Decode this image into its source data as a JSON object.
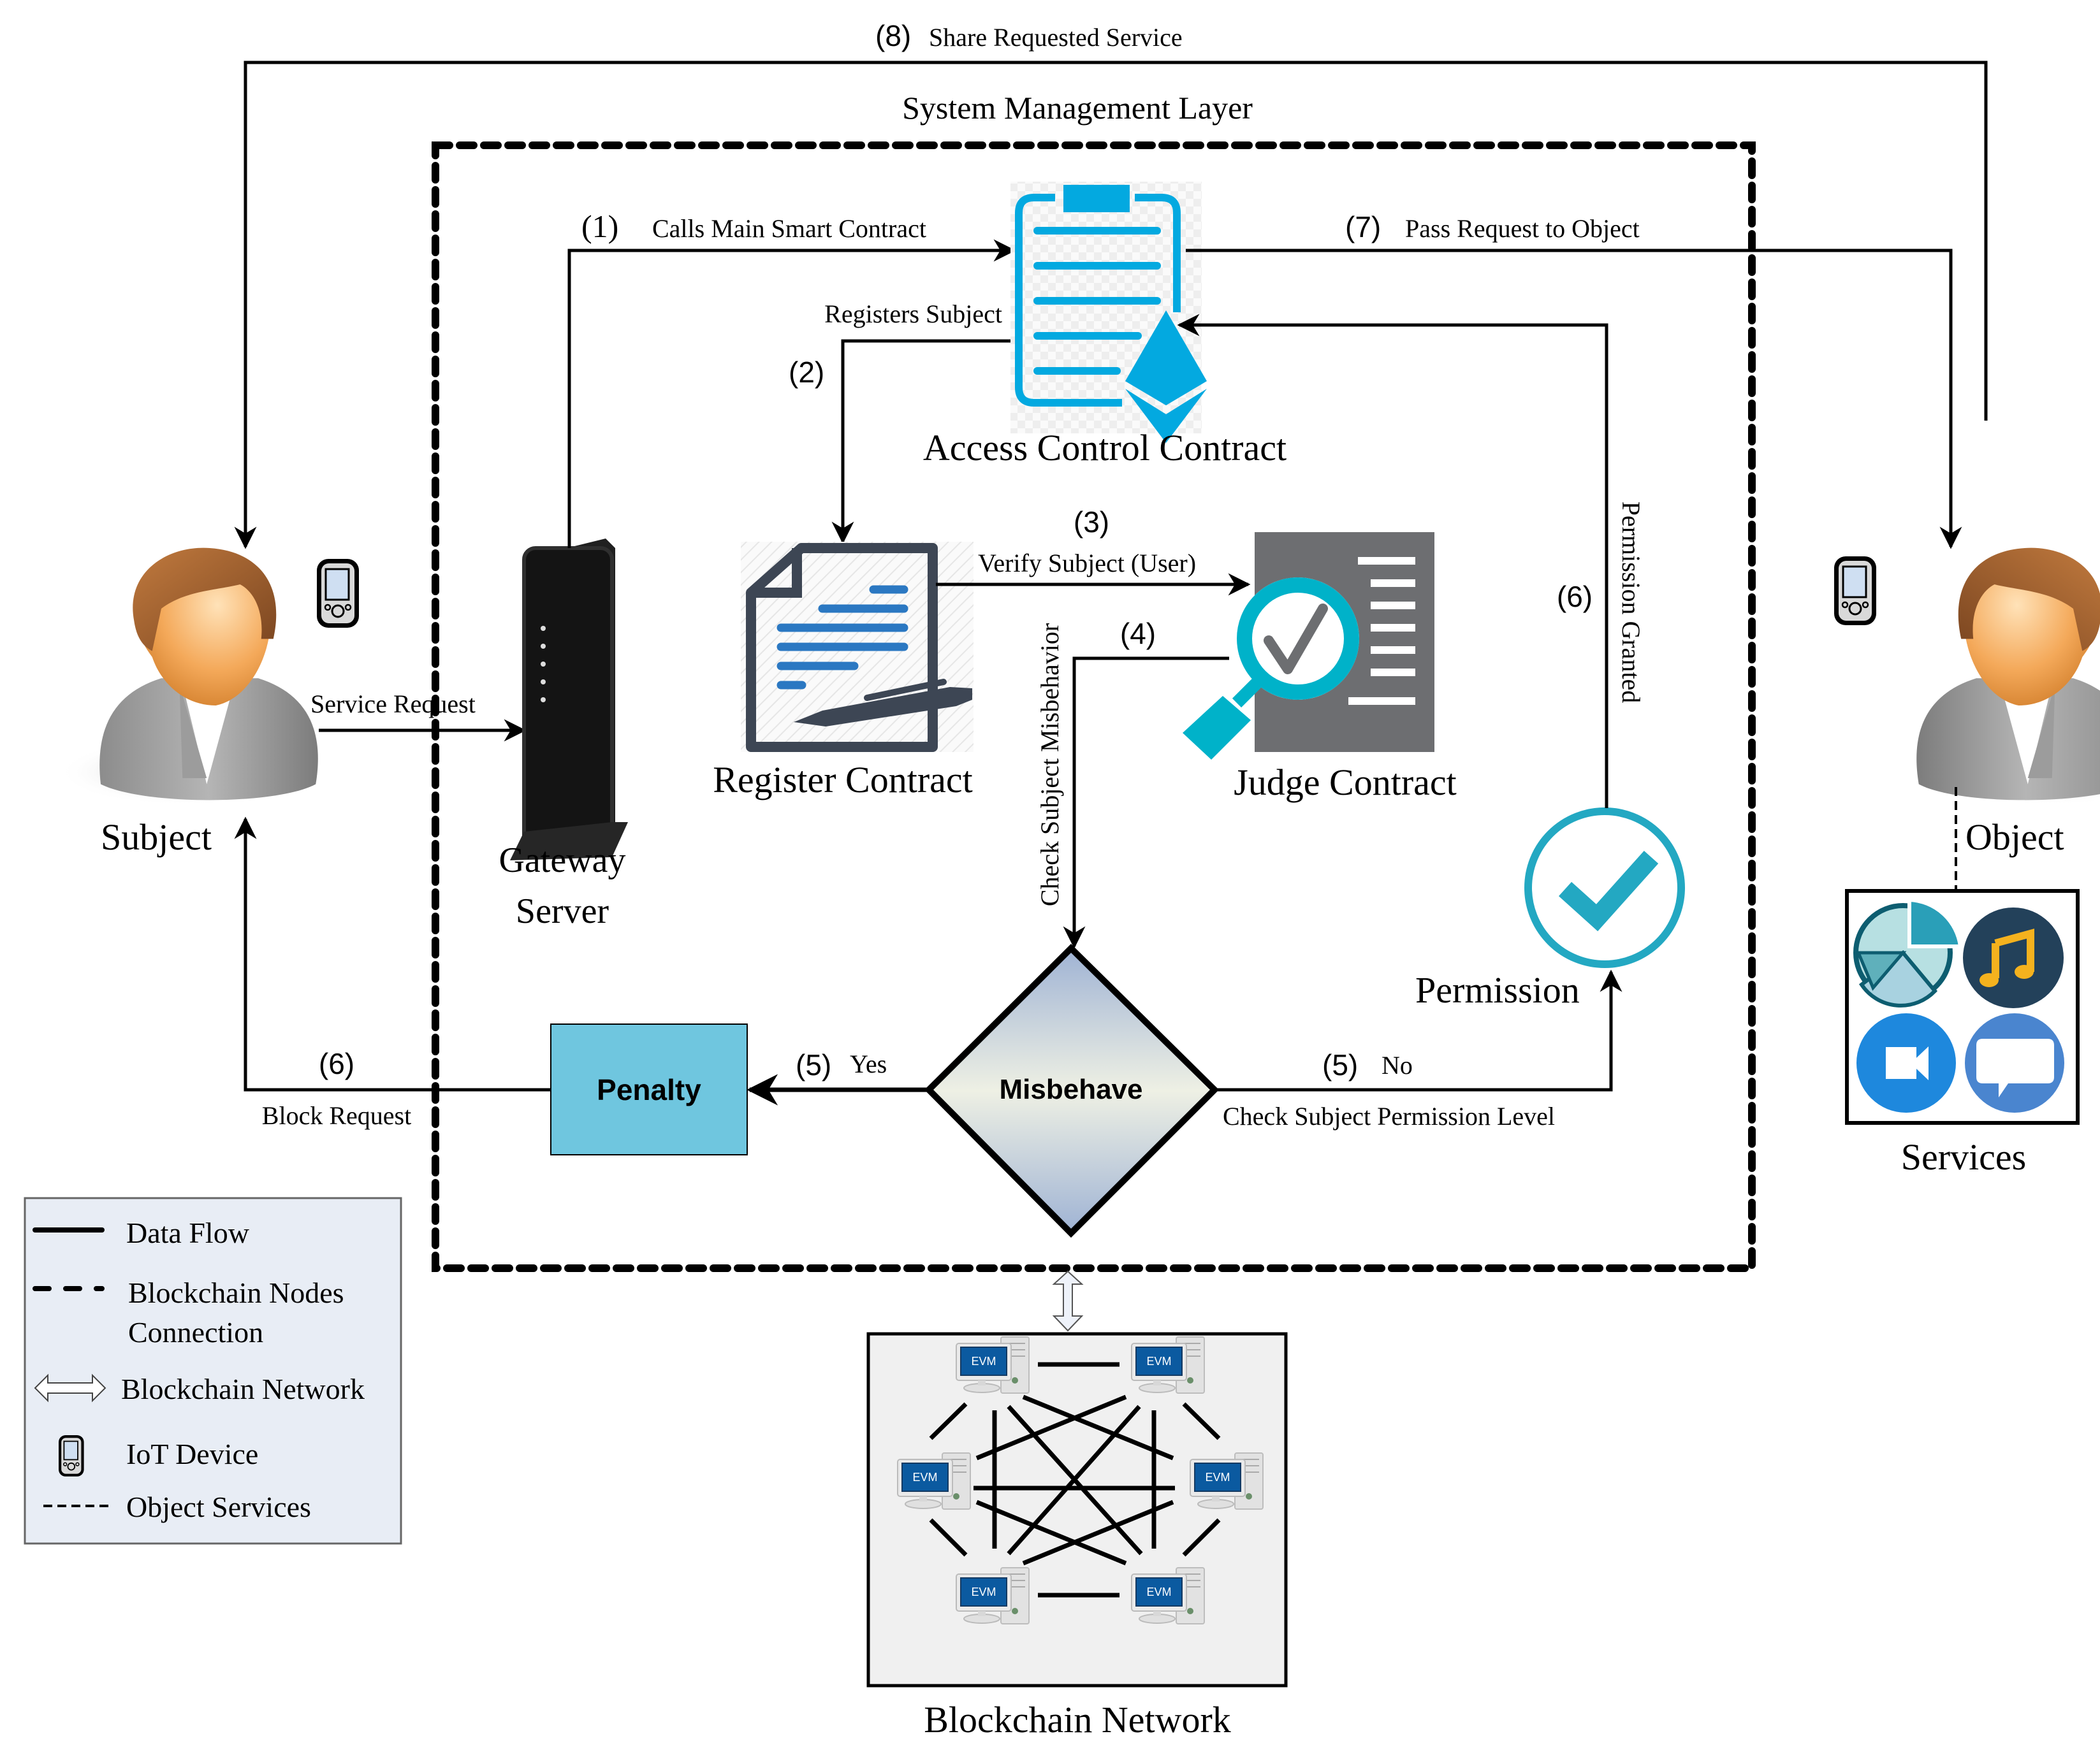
{
  "diagram": {
    "layer_title": "System Management Layer",
    "actors": {
      "subject": "Subject",
      "object": "Object",
      "gateway_line1": "Gateway",
      "gateway_line2": "Server"
    },
    "components": {
      "access_control": "Access Control Contract",
      "register": "Register Contract",
      "judge": "Judge Contract",
      "permission": "Permission",
      "penalty": "Penalty",
      "misbehave": "Misbehave",
      "services": "Services",
      "blockchain": "Blockchain Network",
      "evm_label": "EVM"
    },
    "flows": {
      "step1_num": "(1)",
      "step1_label": "Calls Main Smart Contract",
      "step2_num": "(2)",
      "step2_label": "Registers Subject",
      "step3_num": "(3)",
      "step3_label": "Verify Subject (User)",
      "step4_num": "(4)",
      "step4_label": "Check Subject Misbehavior",
      "step5_yes_num": "(5)",
      "step5_yes_label": "Yes",
      "step5_no_num": "(5)",
      "step5_no_label": "No",
      "step5_no_sub": "Check Subject Permission Level",
      "step6_block_num": "(6)",
      "step6_block_label": "Block Request",
      "step6_grant_num": "(6)",
      "step6_grant_label": "Permission Granted",
      "step7_num": "(7)",
      "step7_label": "Pass Request to Object",
      "step8_num": "(8)",
      "step8_label": "Share Requested Service",
      "service_request": "Service Request"
    },
    "legend": {
      "items": [
        {
          "icon": "solid-line",
          "label": "Data Flow"
        },
        {
          "icon": "thick-dashed-line",
          "label": "Blockchain Nodes",
          "label2": "Connection"
        },
        {
          "icon": "double-arrow",
          "label": "Blockchain Network"
        },
        {
          "icon": "iot-device",
          "label": "IoT Device"
        },
        {
          "icon": "thin-dashed-line",
          "label": "Object Services"
        }
      ]
    },
    "colors": {
      "contract_blue": "#03a9e0",
      "register_blue": "#2b78c2",
      "register_dark": "#3d4654",
      "judge_teal": "#00b2c9",
      "judge_gray": "#6d6e71",
      "permission_teal": "#23a8c2",
      "penalty_fill": "#6fc6df",
      "legend_bg": "#e8edf5",
      "network_bg": "#f0f0f0"
    }
  }
}
